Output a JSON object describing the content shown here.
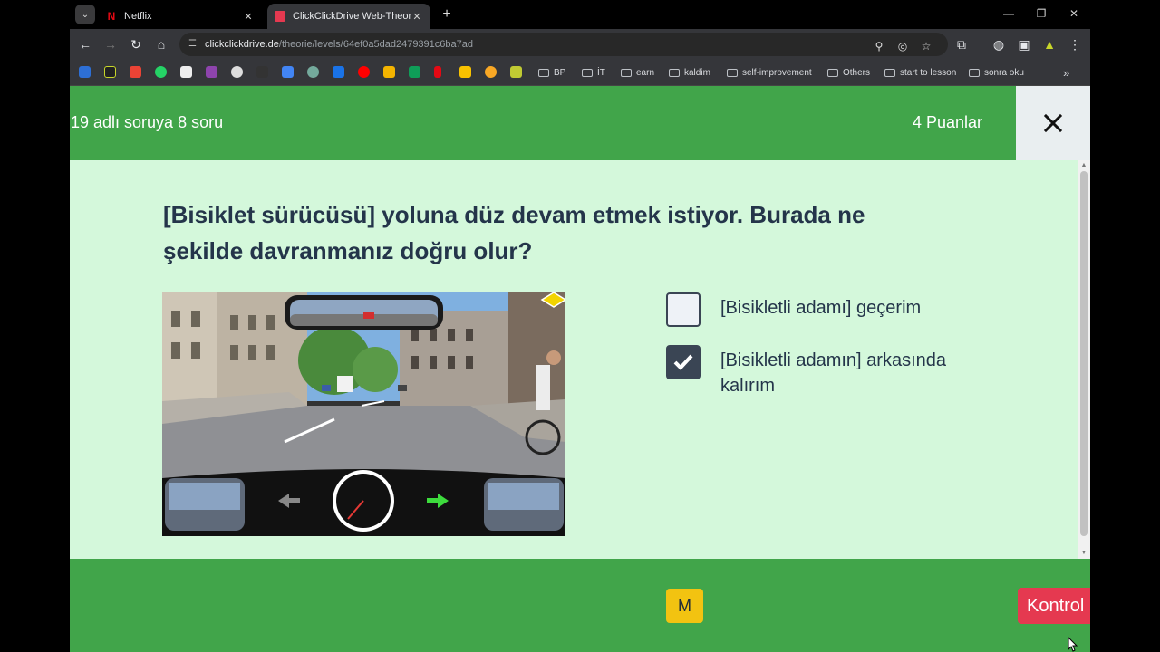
{
  "browser": {
    "tabs": [
      {
        "title": "Netflix",
        "favicon_color": "#e50914",
        "active": false
      },
      {
        "title": "ClickClickDrive Web-Theorie | A",
        "favicon_color": "#e53950",
        "active": true
      }
    ],
    "tab_close_glyph": "✕",
    "new_tab_glyph": "+",
    "url_domain": "clickclickdrive.de",
    "url_path": "/theorie/levels/64ef0a5dad2479391c6ba7ad",
    "bookmark_folders": [
      "BP",
      "İT",
      "earn",
      "kaldim",
      "self-improvement",
      "Others",
      "start to lesson",
      "sonra oku"
    ],
    "more_bookmarks_glyph": "»"
  },
  "quiz": {
    "progress_text": "19 adlı soruya 8 soru",
    "points_text": "4 Puanlar",
    "question": "[Bisiklet sürücüsü] yoluna düz devam etmek istiyor. Burada ne şekilde davranmanız doğru olur?",
    "answers": [
      {
        "text": "[Bisikletli adamı] geçerim",
        "checked": false
      },
      {
        "text": "[Bisikletli adamın] arkasında kalırım",
        "checked": true
      }
    ],
    "m_button": "M",
    "check_button": "Kontrol",
    "colors": {
      "header": "#41a54a",
      "background": "#d4f8db",
      "check_button": "#e53950",
      "m_button": "#f2c311",
      "text": "#24354a"
    }
  }
}
